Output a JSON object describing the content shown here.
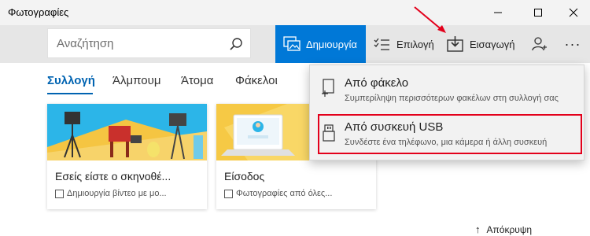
{
  "window": {
    "title": "Φωτογραφίες"
  },
  "search": {
    "placeholder": "Αναζήτηση"
  },
  "toolbar": {
    "create_label": "Δημιουργία",
    "select_label": "Επιλογή",
    "import_label": "Εισαγωγή",
    "more_label": "···"
  },
  "tabs": [
    {
      "label": "Συλλογή",
      "active": true
    },
    {
      "label": "Άλμπουμ",
      "active": false
    },
    {
      "label": "Άτομα",
      "active": false
    },
    {
      "label": "Φάκελοι",
      "active": false
    }
  ],
  "cards": [
    {
      "title": "Εσείς είστε ο σκηνοθέ...",
      "subtitle": "Δημιουργία βίντεο με μο..."
    },
    {
      "title": "Είσοδος",
      "subtitle": "Φωτογραφίες από όλες..."
    }
  ],
  "import_menu": {
    "items": [
      {
        "title": "Από φάκελο",
        "description": "Συμπερίληψη περισσότερων φακέλων στη συλλογή σας",
        "icon": "folder-add-icon"
      },
      {
        "title": "Από συσκευή USB",
        "description": "Συνδέστε ένα τηλέφωνο, μια κάμερα ή άλλη συσκευή",
        "icon": "usb-icon"
      }
    ]
  },
  "footer": {
    "hide_label": "Απόκρυψη"
  },
  "colors": {
    "accent": "#0078d7",
    "highlight": "#e3001b",
    "toolbar_bg": "#e6e6e6",
    "menu_bg": "#f2f2f2"
  }
}
